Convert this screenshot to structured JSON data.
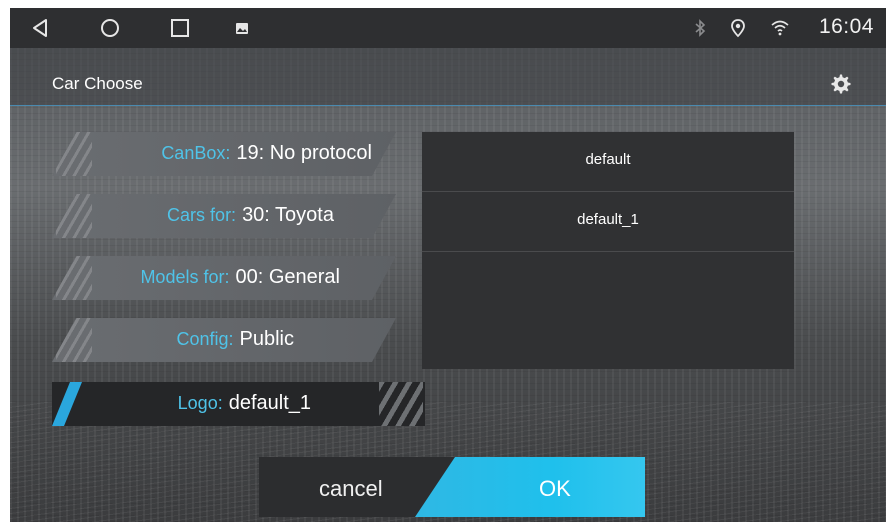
{
  "statusbar": {
    "time": "16:04",
    "nav": [
      "back-icon",
      "home-icon",
      "recents-icon",
      "notification-icon"
    ],
    "icons": [
      "bluetooth-icon",
      "location-icon",
      "wifi-icon"
    ]
  },
  "titlebar": {
    "title": "Car Choose",
    "settings_icon": "gear-icon"
  },
  "options": [
    {
      "label": "CanBox:",
      "value": "19: No protocol"
    },
    {
      "label": "Cars for:",
      "value": "30: Toyota"
    },
    {
      "label": "Models for:",
      "value": "00: General"
    },
    {
      "label": "Config:",
      "value": "Public"
    },
    {
      "label": "Logo:",
      "value": "default_1",
      "active": true
    }
  ],
  "list": {
    "items": [
      "default",
      "default_1"
    ]
  },
  "buttons": {
    "cancel": "cancel",
    "ok": "OK"
  },
  "colors": {
    "accent": "#2fb8e4",
    "label": "#4fc3e8",
    "statusbar": "#2e2f31"
  }
}
